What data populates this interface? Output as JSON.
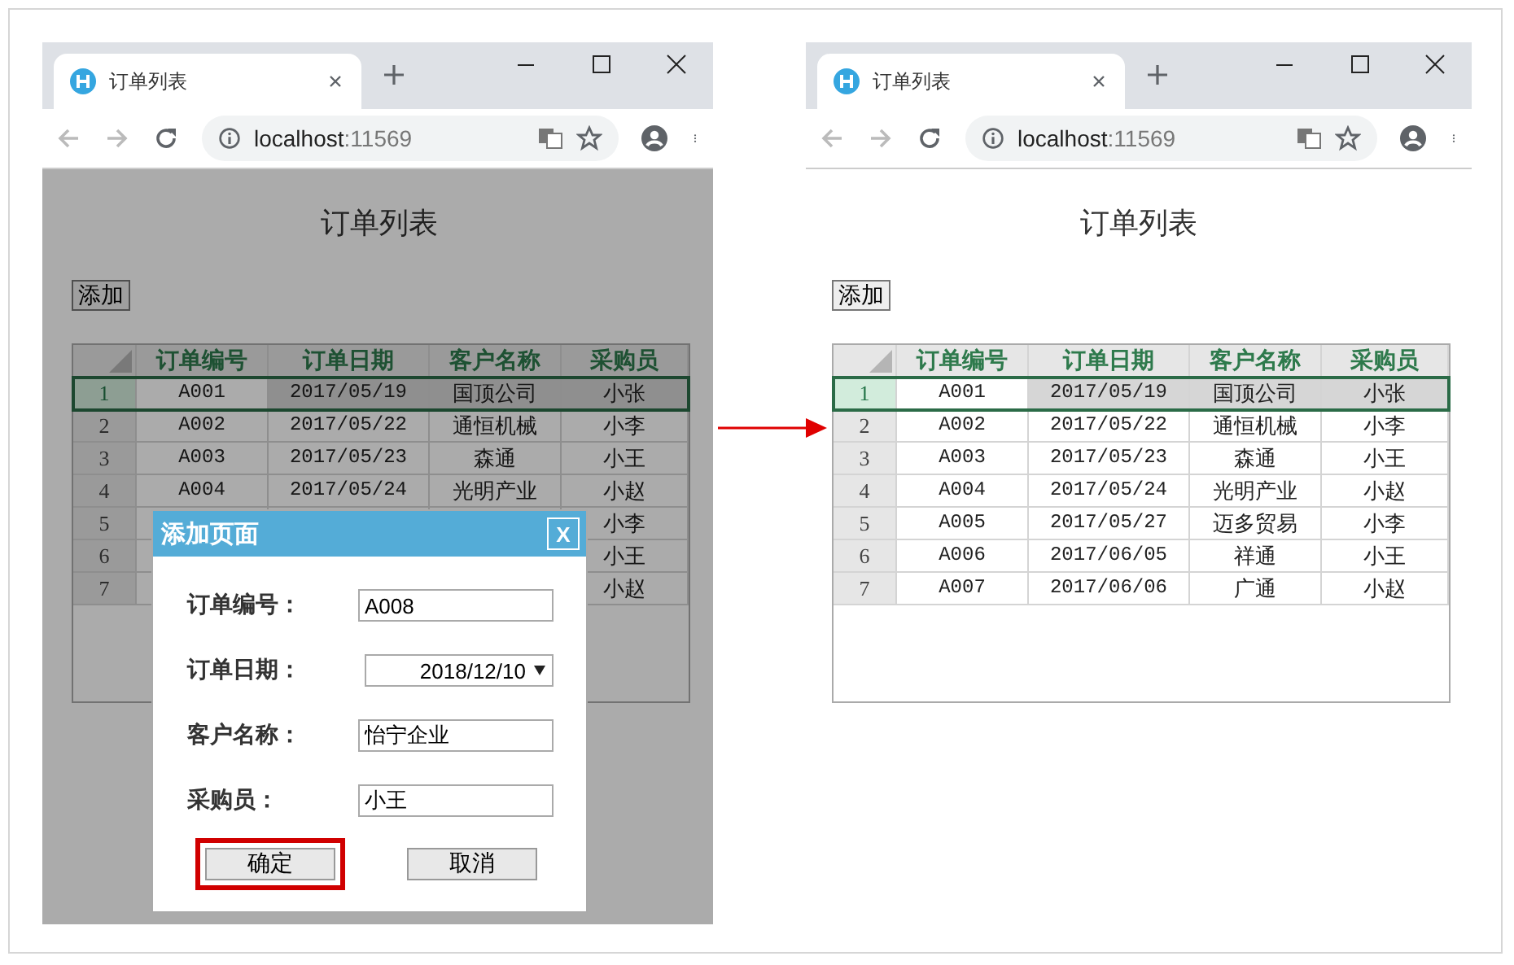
{
  "windows": [
    {
      "tab": {
        "title": "订单列表"
      },
      "address": {
        "host": "localhost",
        "port": ":11569"
      },
      "page": {
        "title": "订单列表",
        "add_button": "添加",
        "table": {
          "columns": [
            "订单编号",
            "订单日期",
            "客户名称",
            "采购员"
          ],
          "rows": [
            {
              "number": "1",
              "selected": true,
              "order_no": "A001",
              "order_date": "2017/05/19",
              "customer": "国顶公司",
              "buyer": "小张"
            },
            {
              "number": "2",
              "selected": false,
              "order_no": "A002",
              "order_date": "2017/05/22",
              "customer": "通恒机械",
              "buyer": "小李"
            },
            {
              "number": "3",
              "selected": false,
              "order_no": "A003",
              "order_date": "2017/05/23",
              "customer": "森通",
              "buyer": "小王"
            },
            {
              "number": "4",
              "selected": false,
              "order_no": "A004",
              "order_date": "2017/05/24",
              "customer": "光明产业",
              "buyer": "小赵"
            },
            {
              "number": "5",
              "selected": false,
              "buyer": "小李"
            },
            {
              "number": "6",
              "selected": false,
              "buyer": "小王"
            },
            {
              "number": "7",
              "selected": false,
              "buyer": "小赵"
            }
          ]
        }
      },
      "dialog": {
        "title": "添加页面",
        "close": "X",
        "fields": [
          {
            "kind": "text",
            "label": "订单编号：",
            "value": "A008"
          },
          {
            "kind": "date",
            "label": "订单日期：",
            "value": "2018/12/10"
          },
          {
            "kind": "text",
            "label": "客户名称：",
            "value": "怡宁企业"
          },
          {
            "kind": "text",
            "label": "采购员：",
            "value": "小王"
          }
        ],
        "buttons": [
          {
            "label": "确定",
            "highlighted": true
          },
          {
            "label": "取消",
            "highlighted": false
          }
        ]
      }
    },
    {
      "tab": {
        "title": "订单列表"
      },
      "address": {
        "host": "localhost",
        "port": ":11569"
      },
      "page": {
        "title": "订单列表",
        "add_button": "添加",
        "table": {
          "columns": [
            "订单编号",
            "订单日期",
            "客户名称",
            "采购员"
          ],
          "rows": [
            {
              "number": "1",
              "selected": true,
              "order_no": "A001",
              "order_date": "2017/05/19",
              "customer": "国顶公司",
              "buyer": "小张"
            },
            {
              "number": "2",
              "selected": false,
              "order_no": "A002",
              "order_date": "2017/05/22",
              "customer": "通恒机械",
              "buyer": "小李"
            },
            {
              "number": "3",
              "selected": false,
              "order_no": "A003",
              "order_date": "2017/05/23",
              "customer": "森通",
              "buyer": "小王"
            },
            {
              "number": "4",
              "selected": false,
              "order_no": "A004",
              "order_date": "2017/05/24",
              "customer": "光明产业",
              "buyer": "小赵"
            },
            {
              "number": "5",
              "selected": false,
              "order_no": "A005",
              "order_date": "2017/05/27",
              "customer": "迈多贸易",
              "buyer": "小李"
            },
            {
              "number": "6",
              "selected": false,
              "order_no": "A006",
              "order_date": "2017/06/05",
              "customer": "祥通",
              "buyer": "小王"
            },
            {
              "number": "7",
              "selected": false,
              "order_no": "A007",
              "order_date": "2017/06/06",
              "customer": "广通",
              "buyer": "小赵"
            }
          ]
        }
      }
    }
  ]
}
